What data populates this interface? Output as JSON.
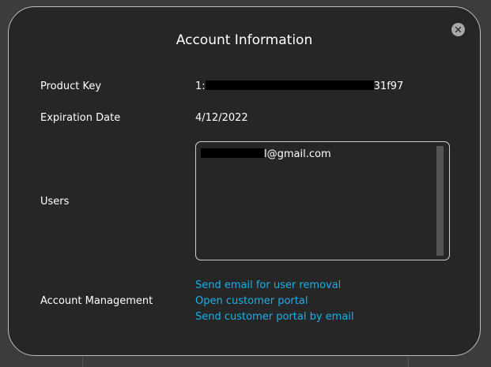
{
  "dialog": {
    "title": "Account Information",
    "close_icon": "close-icon"
  },
  "fields": {
    "product_key": {
      "label": "Product Key",
      "prefix": "1:",
      "suffix": "31f97"
    },
    "expiration": {
      "label": "Expiration Date",
      "value": "4/12/2022"
    },
    "users": {
      "label": "Users",
      "entries": [
        {
          "suffix": "l@gmail.com"
        }
      ]
    },
    "account_management": {
      "label": "Account Management",
      "links": [
        "Send email for user removal",
        "Open customer portal",
        "Send customer portal by email"
      ]
    }
  },
  "colors": {
    "background": "#262626",
    "text": "#ffffff",
    "link": "#1ab0e8",
    "border": "#bdbdbd"
  }
}
